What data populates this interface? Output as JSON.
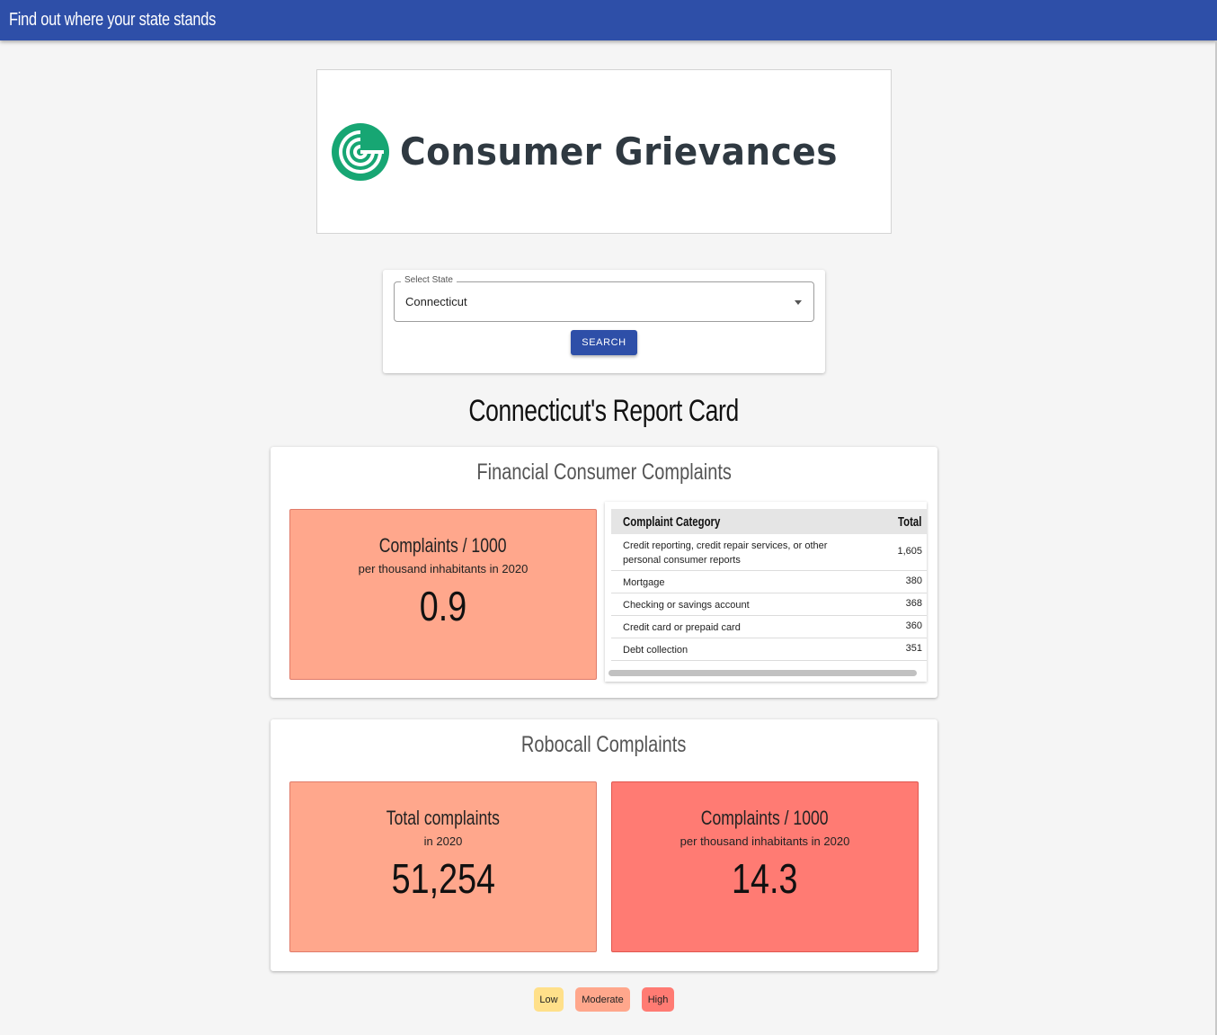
{
  "header": {
    "title": "Find out where your state stands"
  },
  "logo": {
    "text": "Consumer Grievances"
  },
  "search": {
    "label": "Select State",
    "selected_state": "Connecticut",
    "button_label": "SEARCH"
  },
  "report": {
    "title": "Connecticut's Report Card"
  },
  "financial": {
    "title": "Financial Consumer Complaints",
    "stat": {
      "heading": "Complaints / 1000",
      "sub": "per thousand inhabitants in 2020",
      "value": "0.9",
      "level": "Moderate"
    },
    "table": {
      "headers": {
        "category": "Complaint Category",
        "total": "Total"
      },
      "rows": [
        {
          "category": "Credit reporting, credit repair services, or other personal consumer reports",
          "total": "1,605"
        },
        {
          "category": "Mortgage",
          "total": "380"
        },
        {
          "category": "Checking or savings account",
          "total": "368"
        },
        {
          "category": "Credit card or prepaid card",
          "total": "360"
        },
        {
          "category": "Debt collection",
          "total": "351"
        }
      ]
    }
  },
  "robocall": {
    "title": "Robocall Complaints",
    "stats": [
      {
        "heading": "Total complaints",
        "sub": "in 2020",
        "value": "51,254",
        "level": "Moderate"
      },
      {
        "heading": "Complaints / 1000",
        "sub": "per thousand inhabitants in 2020",
        "value": "14.3",
        "level": "High"
      }
    ]
  },
  "legend": [
    {
      "label": "Low",
      "color": "#ffe08a"
    },
    {
      "label": "Moderate",
      "color": "#ffa78c"
    },
    {
      "label": "High",
      "color": "#ff7b73"
    }
  ],
  "colors": {
    "primary": "#2e4fa8",
    "low": "#ffe08a",
    "moderate": "#ffa78c",
    "high": "#ff7b73",
    "logo_green": "#17a673"
  }
}
